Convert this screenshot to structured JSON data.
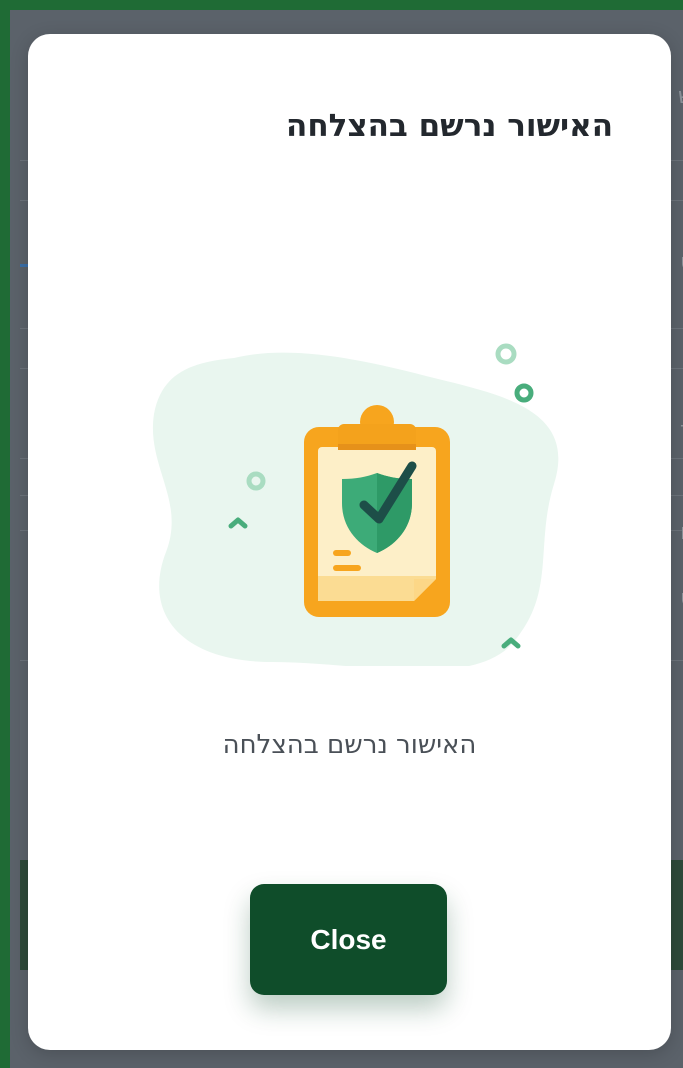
{
  "modal": {
    "title": "האישור נרשם בהצלחה",
    "message": "האישור נרשם בהצלחה",
    "close_label": "Close",
    "illustration_icon": "clipboard-shield-check-icon"
  },
  "colors": {
    "primary_button": "#0f4d2a",
    "illustration_green": "#3dab78",
    "illustration_orange": "#f7a51e",
    "illustration_cream": "#fdefc8",
    "backdrop": "#5b626a",
    "frame_border": "#1f6b35"
  }
}
